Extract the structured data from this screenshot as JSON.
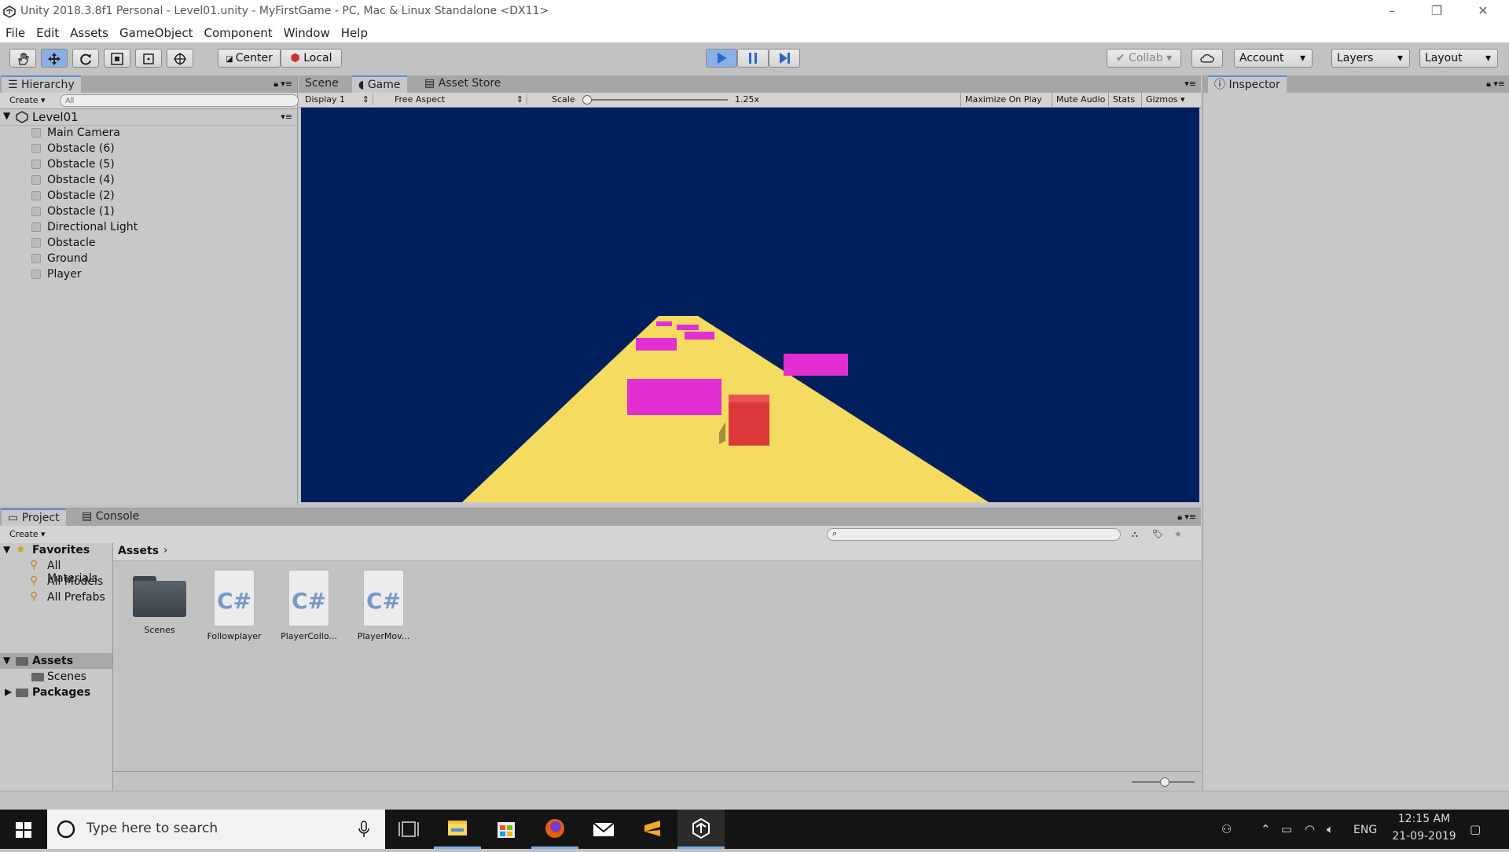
{
  "window": {
    "title": "Unity 2018.3.8f1 Personal - Level01.unity - MyFirstGame - PC, Mac & Linux Standalone <DX11>"
  },
  "menu": [
    "File",
    "Edit",
    "Assets",
    "GameObject",
    "Component",
    "Window",
    "Help"
  ],
  "toolbar": {
    "pivot_label": "Center",
    "space_label": "Local",
    "collab_label": "Collab",
    "account_label": "Account",
    "layers_label": "Layers",
    "layout_label": "Layout"
  },
  "hierarchy": {
    "tab": "Hierarchy",
    "create_label": "Create",
    "search_placeholder": "All",
    "scene": "Level01",
    "items": [
      "Main Camera",
      "Obstacle (6)",
      "Obstacle (5)",
      "Obstacle (4)",
      "Obstacle (2)",
      "Obstacle (1)",
      "Directional Light",
      "Obstacle",
      "Ground",
      "Player"
    ]
  },
  "game_view": {
    "tabs": [
      "Scene",
      "Game",
      "Asset Store"
    ],
    "display": "Display 1",
    "aspect": "Free Aspect",
    "scale_label": "Scale",
    "scale_value": "1.25x",
    "scale_fraction": 0.02,
    "buttons": [
      "Maximize On Play",
      "Mute Audio",
      "Stats",
      "Gizmos"
    ],
    "sky_color": "#00205d",
    "ground_color": "#f5dc60",
    "obstacle_color": "#e12fd2",
    "player_color": "#dc3a3a"
  },
  "inspector": {
    "tab": "Inspector"
  },
  "project": {
    "tabs": [
      "Project",
      "Console"
    ],
    "create_label": "Create",
    "favorites_label": "Favorites",
    "favorites": [
      "All Materials",
      "All Models",
      "All Prefabs"
    ],
    "assets_label": "Assets",
    "assets_children": [
      "Scenes"
    ],
    "packages_label": "Packages",
    "breadcrumb": "Assets",
    "files": [
      {
        "name": "Scenes",
        "kind": "folder"
      },
      {
        "name": "Followplayer",
        "kind": "script"
      },
      {
        "name": "PlayerCollo...",
        "kind": "script"
      },
      {
        "name": "PlayerMov...",
        "kind": "script"
      }
    ],
    "script_glyph": "C#"
  },
  "taskbar": {
    "search_placeholder": "Type here to search",
    "language": "ENG",
    "time": "12:15 AM",
    "date": "21-09-2019"
  }
}
